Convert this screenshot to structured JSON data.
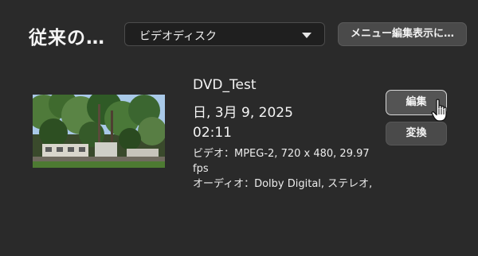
{
  "header": {
    "title": "従来の…",
    "format_select": {
      "selected": "ビデオディスク",
      "icon": "chevron-down-icon"
    },
    "menu_button_label": "メニュー編集表示に…"
  },
  "disc": {
    "title": "DVD_Test",
    "date": "日, 3月 9, 2025",
    "duration": "02:11",
    "video": "ビデオ：MPEG-2, 720 x 480, 29.97 fps",
    "audio": "オーディオ：Dolby Digital, ステレオ,",
    "thumbnail": "trees-and-building-thumbnail"
  },
  "actions": {
    "edit_label": "編集",
    "convert_label": "変換"
  },
  "cursor": "hand-pointer-icon"
}
